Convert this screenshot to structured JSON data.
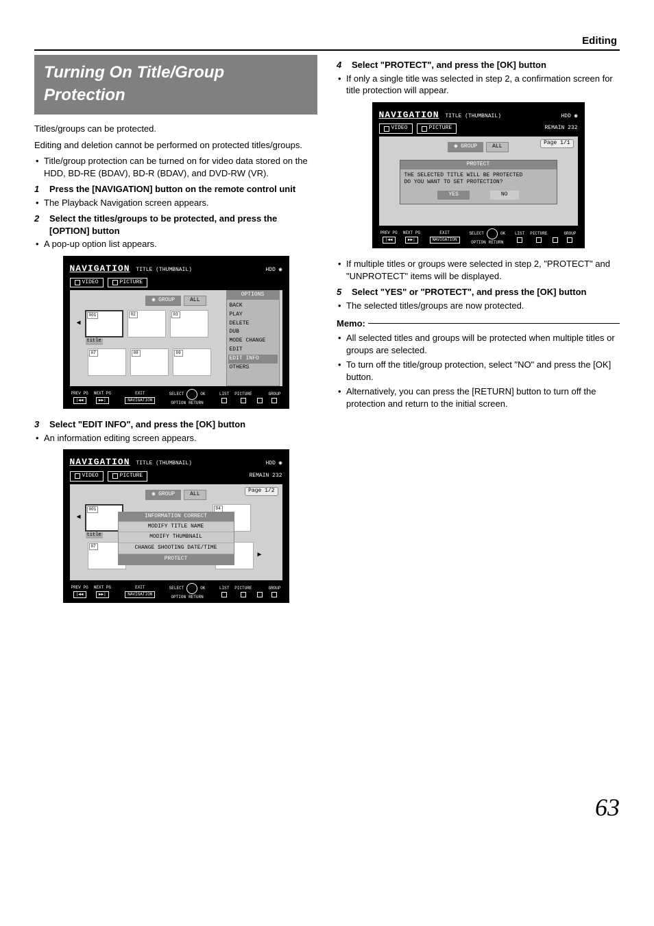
{
  "section_header": "Editing",
  "page_number": "63",
  "left": {
    "title": "Turning On Title/Group Protection",
    "intro1": "Titles/groups can be protected.",
    "intro2": "Editing and deletion cannot be performed on protected titles/groups.",
    "bullet1": "Title/group protection can be turned on for video data stored on the HDD, BD-RE (BDAV), BD-R (BDAV), and DVD-RW (VR).",
    "step1_num": "1",
    "step1": "Press the [NAVIGATION] button on the remote control unit",
    "step1_body": "The Playback Navigation screen appears.",
    "step2_num": "2",
    "step2": "Select the titles/groups to be protected, and press the [OPTION] button",
    "step2_body": "A pop-up option list appears.",
    "step3_num": "3",
    "step3": "Select \"EDIT INFO\", and press the [OK] button",
    "step3_body": "An information editing screen appears."
  },
  "right": {
    "step4_num": "4",
    "step4": "Select \"PROTECT\", and press the [OK] button",
    "step4_body": "If only a single title was selected in step 2, a confirmation screen for title protection will appear.",
    "after4": "If multiple titles or groups were selected in step 2, \"PROTECT\" and \"UNPROTECT\" items will be displayed.",
    "step5_num": "5",
    "step5": "Select \"YES\" or \"PROTECT\", and press the [OK] button",
    "step5_body": "The selected titles/groups are now protected.",
    "memo_label": "Memo:",
    "memo1": "All selected titles and groups will be protected when multiple titles or groups are selected.",
    "memo2": "To turn off the title/group protection, select \"NO\" and press the [OK] button.",
    "memo3": "Alternatively, you can press the [RETURN] button to turn off the protection and return to the initial screen."
  },
  "fig": {
    "nav_title": "NAVIGATION",
    "nav_sub": "TITLE (THUMBNAIL)",
    "hdd": "HDD",
    "tab_video": "VIDEO",
    "tab_picture": "PICTURE",
    "remain": "REMAIN 232",
    "group": "GROUP",
    "all": "ALL",
    "page11": "Page   1/1",
    "page12": "Page   1/2",
    "title_label": "title",
    "thumb_nums": {
      "a": "001",
      "b": "02",
      "c": "03",
      "d": "04",
      "e": "07",
      "f": "08",
      "g": "09"
    },
    "options_head": "OPTIONS",
    "options": {
      "back": "BACK",
      "play": "PLAY",
      "delete": "DELETE",
      "dub": "DUB",
      "mode": "MODE CHANGE",
      "edit": "EDIT",
      "editinfo": "EDIT INFO",
      "others": "OTHERS"
    },
    "info_head": "INFORMATION CORRECT",
    "info": {
      "name": "MODIFY TITLE NAME",
      "thumb": "MODIFY THUMBNAIL",
      "date": "CHANGE SHOOTING DATE/TIME",
      "protect": "PROTECT"
    },
    "protect_head": "PROTECT",
    "protect_msg1": "THE SELECTED TITLE WILL BE PROTECTED",
    "protect_msg2": "DO YOU WANT TO SET PROTECTION?",
    "yes": "YES",
    "no": "NO",
    "foot": {
      "prev": "PREV PG",
      "next": "NEXT PG",
      "exit": "EXIT",
      "select": "SELECT",
      "ok": "OK",
      "option": "OPTION",
      "return": "RETURN",
      "list": "LIST",
      "picture": "PICTURE",
      "group": "GROUP",
      "navkey": "NAVIGATION"
    }
  }
}
